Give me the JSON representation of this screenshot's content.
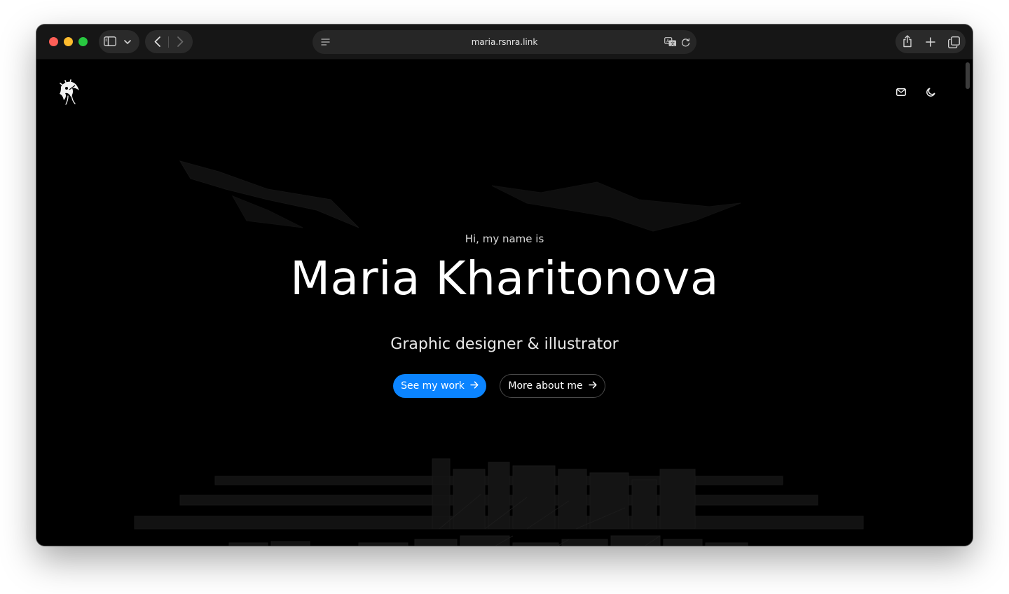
{
  "browser": {
    "url": "maria.rsnra.link",
    "icons": {
      "sidebar": "sidebar-icon",
      "chevron": "chevron-down-icon",
      "back": "chevron-left-icon",
      "forward": "chevron-right-icon",
      "reader": "reader-icon",
      "translate": "translate-icon",
      "reload": "reload-icon",
      "share": "share-icon",
      "new_tab": "plus-icon",
      "tabs": "tabs-overview-icon"
    }
  },
  "header": {
    "logo": "logo-icon",
    "mail_icon": "mail-icon",
    "theme_icon": "moon-icon"
  },
  "hero": {
    "greeting": "Hi, my name is",
    "name": "Maria Kharitonova",
    "role": "Graphic designer & illustrator",
    "primary_button": "See my work",
    "secondary_button": "More about me",
    "arrow_icon": "arrow-right-icon"
  },
  "colors": {
    "accent": "#0b84ff",
    "background": "#000000",
    "text": "#ffffff"
  }
}
